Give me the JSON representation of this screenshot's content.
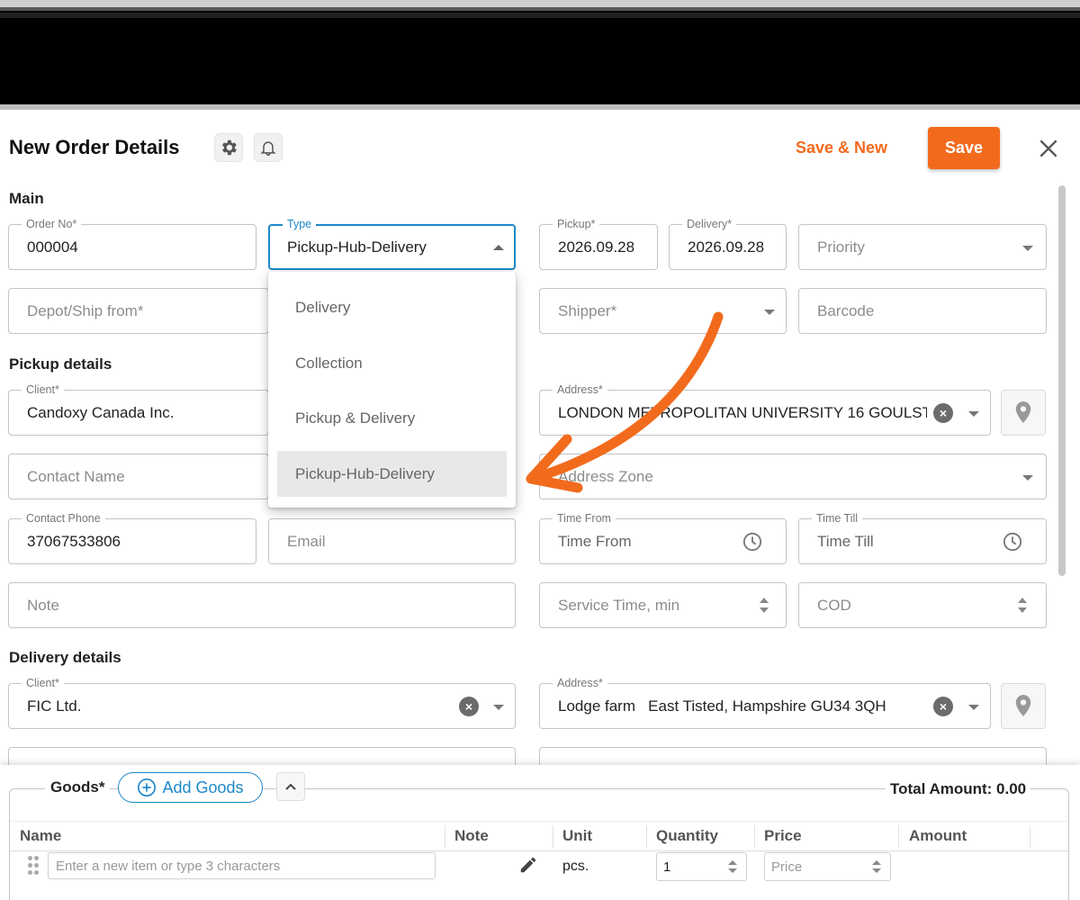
{
  "header": {
    "title": "New Order Details",
    "save_new_label": "Save & New",
    "save_label": "Save",
    "accent_color": "#f26b1d"
  },
  "main": {
    "section_label": "Main",
    "order_no": {
      "label": "Order No*",
      "value": "000004"
    },
    "type": {
      "label": "Type",
      "value": "Pickup-Hub-Delivery"
    },
    "pickup": {
      "label": "Pickup*",
      "value": "2026.09.28"
    },
    "delivery": {
      "label": "Delivery*",
      "value": "2026.09.28"
    },
    "priority": {
      "placeholder": "Priority"
    },
    "depot": {
      "placeholder": "Depot/Ship from*"
    },
    "shipper": {
      "placeholder": "Shipper*"
    },
    "barcode": {
      "placeholder": "Barcode"
    }
  },
  "type_dropdown": {
    "options": [
      "Delivery",
      "Collection",
      "Pickup & Delivery",
      "Pickup-Hub-Delivery"
    ],
    "selected": "Pickup-Hub-Delivery"
  },
  "pickup_details": {
    "section_label": "Pickup details",
    "client": {
      "label": "Client*",
      "value": "Candoxy Canada Inc."
    },
    "address": {
      "label": "Address*",
      "value": "LONDON METROPOLITAN UNIVERSITY 16 GOULST"
    },
    "contact_name": {
      "placeholder": "Contact Name"
    },
    "address_zone": {
      "placeholder": "Address Zone"
    },
    "contact_phone": {
      "label": "Contact Phone",
      "value": "37067533806"
    },
    "email": {
      "placeholder": "Email"
    },
    "time_from": {
      "label": "Time From",
      "placeholder": "Time From"
    },
    "time_till": {
      "label": "Time Till",
      "placeholder": "Time Till"
    },
    "note": {
      "placeholder": "Note"
    },
    "service_time": {
      "placeholder": "Service Time, min"
    },
    "cod": {
      "placeholder": "COD"
    }
  },
  "delivery_details": {
    "section_label": "Delivery details",
    "client": {
      "label": "Client*",
      "value": "FIC Ltd."
    },
    "address": {
      "label": "Address*",
      "value": "Lodge farm   East Tisted, Hampshire GU34 3QH"
    }
  },
  "goods": {
    "title": "Goods*",
    "add_label": "Add Goods",
    "total_label": "Total Amount: 0.00",
    "columns": [
      "Name",
      "Note",
      "Unit",
      "Quantity",
      "Price",
      "Amount"
    ],
    "row": {
      "name_placeholder": "Enter a new item or type 3 characters",
      "unit": "pcs.",
      "quantity": "1",
      "price_placeholder": "Price"
    }
  }
}
